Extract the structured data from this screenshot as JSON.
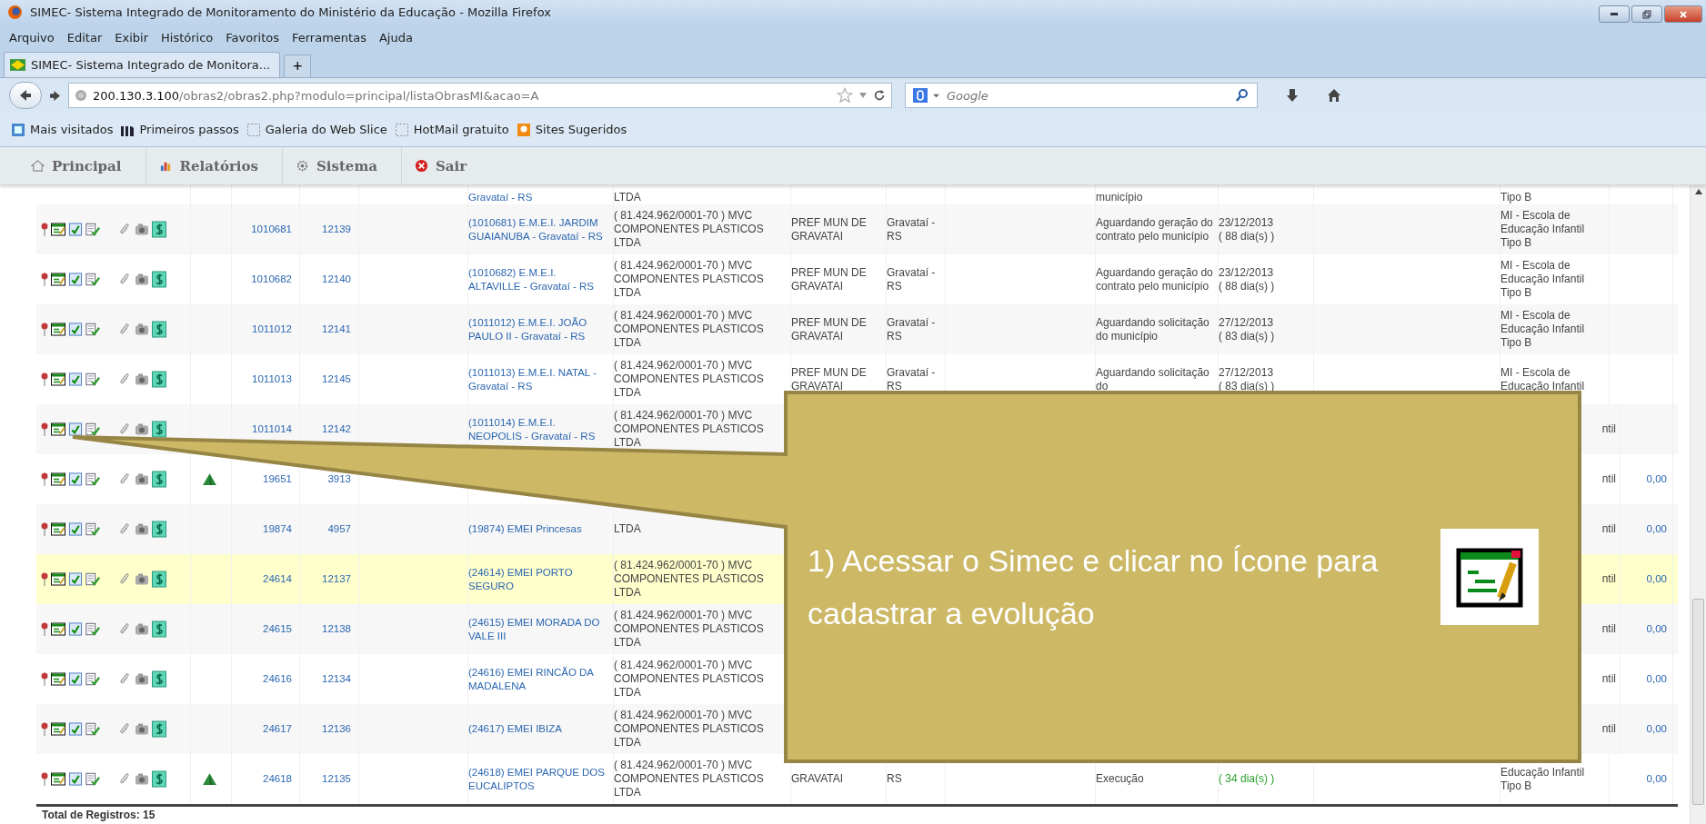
{
  "window": {
    "title": "SIMEC- Sistema Integrado de Monitoramento do Ministério da Educação - Mozilla Firefox"
  },
  "menu": [
    "Arquivo",
    "Editar",
    "Exibir",
    "Histórico",
    "Favoritos",
    "Ferramentas",
    "Ajuda"
  ],
  "tabs": [
    {
      "label": "SIMEC- Sistema Integrado de Monitora...",
      "selected": true
    }
  ],
  "new_tab": "+",
  "address": {
    "host": "200.130.3.100",
    "path": "/obras2/obras2.php?modulo=principal/listaObrasMI&acao=A"
  },
  "search": {
    "placeholder": "Google"
  },
  "bookmarks": [
    {
      "label": "Mais visitados",
      "kind": "list"
    },
    {
      "label": "Primeiros passos",
      "kind": "logo"
    },
    {
      "label": "Galeria do Web Slice",
      "kind": "slice"
    },
    {
      "label": "HotMail gratuito",
      "kind": "slice"
    },
    {
      "label": "Sites Sugeridos",
      "kind": "tip"
    }
  ],
  "app_nav": [
    {
      "label": "Principal",
      "kind": "home"
    },
    {
      "label": "Relatórios",
      "kind": "chart"
    },
    {
      "label": "Sistema",
      "kind": "gear"
    },
    {
      "label": "Sair",
      "kind": "exit"
    }
  ],
  "rows": [
    {
      "partial": true,
      "highlighted": false,
      "name": "Gravataí - RS",
      "company": "LTDA",
      "status": "município",
      "type": {
        "text": "Tipo B",
        "clipped": false
      }
    },
    {
      "partial": false,
      "highlighted": false,
      "flag": false,
      "id": "1010681",
      "code": "12139",
      "name": "(1010681) E.M.E.I. JARDIM GUAIANUBA - Gravataí - RS",
      "company": "( 81.424.962/0001-70 ) MVC COMPONENTES PLASTICOS LTDA",
      "owner": "PREF MUN DE GRAVATAI",
      "city": "Gravataí - RS",
      "status": "Aguardando geração do contrato pelo município",
      "date": "23/12/2013",
      "days": "( 88 dia(s) )",
      "late": false,
      "type": {
        "text": "MI - Escola de Educação Infantil Tipo B",
        "clipped": false
      }
    },
    {
      "partial": false,
      "highlighted": false,
      "flag": false,
      "id": "1010682",
      "code": "12140",
      "name": "(1010682) E.M.E.I. ALTAVILLE - Gravataí - RS",
      "company": "( 81.424.962/0001-70 ) MVC COMPONENTES PLASTICOS LTDA",
      "owner": "PREF MUN DE GRAVATAI",
      "city": "Gravataí - RS",
      "status": "Aguardando geração do contrato pelo município",
      "date": "23/12/2013",
      "days": "( 88 dia(s) )",
      "late": false,
      "type": {
        "text": "MI - Escola de Educação Infantil Tipo B",
        "clipped": false
      }
    },
    {
      "partial": false,
      "highlighted": false,
      "flag": false,
      "id": "1011012",
      "code": "12141",
      "name": "(1011012) E.M.E.I. JOÃO PAULO II - Gravataí - RS",
      "company": "( 81.424.962/0001-70 ) MVC COMPONENTES PLASTICOS LTDA",
      "owner": "PREF MUN DE GRAVATAI",
      "city": "Gravataí - RS",
      "status": "Aguardando solicitação do município",
      "date": "27/12/2013",
      "days": "( 83 dia(s) )",
      "late": false,
      "type": {
        "text": "MI - Escola de Educação Infantil Tipo B",
        "clipped": false
      }
    },
    {
      "partial": false,
      "highlighted": false,
      "flag": false,
      "id": "1011013",
      "code": "12145",
      "name": "(1011013) E.M.E.I. NATAL - Gravataí - RS",
      "company": "( 81.424.962/0001-70 ) MVC COMPONENTES PLASTICOS LTDA",
      "owner": "PREF MUN DE GRAVATAI",
      "city": "Gravataí - RS",
      "status": "Aguardando solicitação do",
      "date": "27/12/2013",
      "days": "( 83 dia(s) )",
      "late": false,
      "type": {
        "text": "MI - Escola de Educação Infantil",
        "clipped": false
      }
    },
    {
      "partial": false,
      "highlighted": false,
      "flag": false,
      "id": "1011014",
      "code": "12142",
      "name": "(1011014) E.M.E.I. NEOPOLIS - Gravataí - RS",
      "company": "( 81.424.962/0001-70 ) MVC COMPONENTES PLASTICOS LTDA",
      "type": {
        "text": "ntil",
        "clipped": true
      }
    },
    {
      "partial": false,
      "highlighted": false,
      "flag": true,
      "id": "19651",
      "code": "3913",
      "type": {
        "text": "ntil",
        "clipped": true
      },
      "value": "0,00"
    },
    {
      "partial": false,
      "highlighted": false,
      "flag": false,
      "id": "19874",
      "code": "4957",
      "name": "(19874) EMEI Princesas",
      "company": "LTDA",
      "type": {
        "text": "ntil",
        "clipped": true
      },
      "value": "0,00"
    },
    {
      "partial": false,
      "highlighted": true,
      "flag": false,
      "id": "24614",
      "code": "12137",
      "name": "(24614) EMEI PORTO SEGURO",
      "company": "( 81.424.962/0001-70 ) MVC COMPONENTES PLASTICOS LTDA",
      "type": {
        "text": "ntil",
        "clipped": true
      },
      "value": "0,00"
    },
    {
      "partial": false,
      "highlighted": false,
      "flag": false,
      "id": "24615",
      "code": "12138",
      "name": "(24615) EMEI MORADA DO VALE III",
      "company": "( 81.424.962/0001-70 ) MVC COMPONENTES PLASTICOS LTDA",
      "type": {
        "text": "ntil",
        "clipped": true
      },
      "value": "0,00"
    },
    {
      "partial": false,
      "highlighted": false,
      "flag": false,
      "id": "24616",
      "code": "12134",
      "name": "(24616) EMEI RINCÃO DA MADALENA",
      "company": "( 81.424.962/0001-70 ) MVC COMPONENTES PLASTICOS LTDA",
      "type": {
        "text": "ntil",
        "clipped": true
      },
      "value": "0,00"
    },
    {
      "partial": false,
      "highlighted": false,
      "flag": false,
      "id": "24617",
      "code": "12136",
      "name": "(24617) EMEI IBIZA",
      "company": "( 81.424.962/0001-70 ) MVC COMPONENTES PLASTICOS LTDA",
      "type": {
        "text": "ntil",
        "clipped": true
      },
      "value": "0,00"
    },
    {
      "partial": false,
      "highlighted": false,
      "flag": true,
      "id": "24618",
      "code": "12135",
      "name": "(24618) EMEI PARQUE DOS EUCALIPTOS",
      "company": "( 81.424.962/0001-70 ) MVC COMPONENTES PLASTICOS LTDA",
      "owner": "GRAVATAI",
      "city": "RS",
      "status": "Execução",
      "days": "( 34 dia(s) )",
      "late": true,
      "type": {
        "text": "Educação Infantil Tipo B",
        "clipped": false
      },
      "value": "0,00"
    }
  ],
  "total": "Total de Registros: 15",
  "callout": {
    "text": "1) Acessar o Simec e clicar no Ícone para cadastrar a evolução"
  }
}
